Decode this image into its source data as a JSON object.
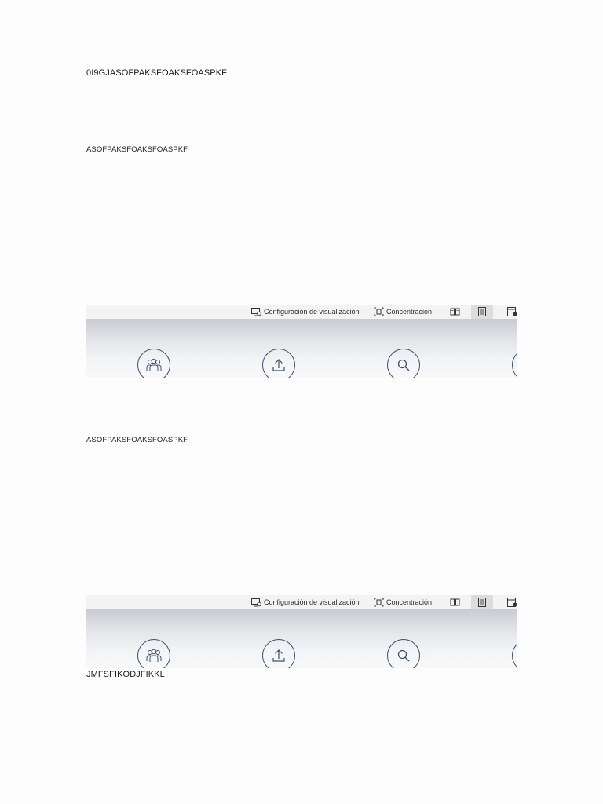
{
  "document": {
    "line1": "0I9GJASOFPAKSFOAKSFOASPKF",
    "line2": "ASOFPAKSFOAKSFOASPKF",
    "line3": "ASOFPAKSFOAKSFOASPKF",
    "line4": "JMFSFIKODJFIKKL"
  },
  "embedded_screenshot": {
    "toolbar": {
      "display_settings_label": "Configuración de visualización",
      "focus_label": "Concentración"
    },
    "toolbar_icons": [
      "display-settings-icon",
      "focus-icon",
      "read-mode-icon",
      "print-layout-icon",
      "web-layout-icon"
    ],
    "action_icons": [
      "people-icon",
      "upload-icon",
      "search-icon",
      "partial-circle-icon"
    ]
  }
}
